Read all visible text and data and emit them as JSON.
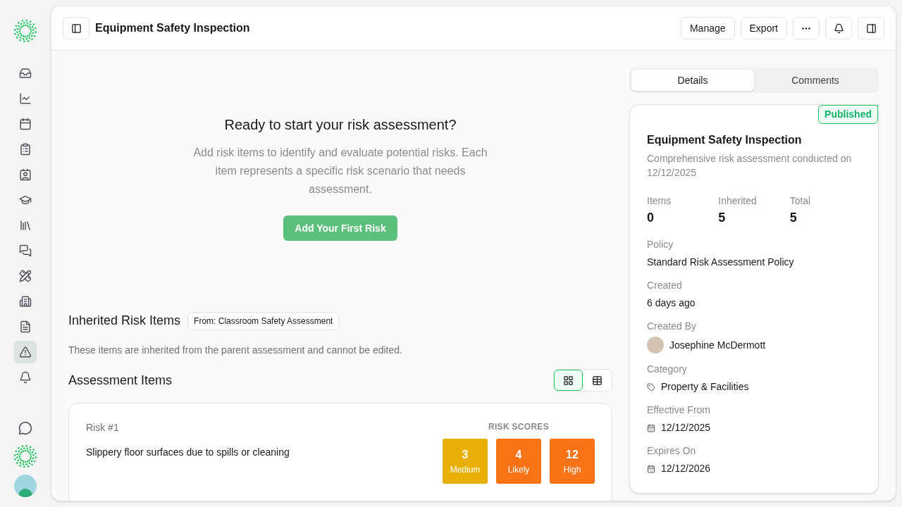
{
  "sidebar": {
    "items": [
      {
        "kind": "inbox",
        "selected": false
      },
      {
        "kind": "chart",
        "selected": false
      },
      {
        "kind": "calendar",
        "selected": false
      },
      {
        "kind": "clipboard",
        "selected": false
      },
      {
        "kind": "contacts",
        "selected": false
      },
      {
        "kind": "graduation",
        "selected": false
      },
      {
        "kind": "library",
        "selected": false
      },
      {
        "kind": "messages",
        "selected": false
      },
      {
        "kind": "pencil-ruler",
        "selected": false
      },
      {
        "kind": "building",
        "selected": false
      },
      {
        "kind": "document",
        "selected": false
      },
      {
        "kind": "warning",
        "selected": true
      },
      {
        "kind": "bell",
        "selected": false
      }
    ]
  },
  "header": {
    "title": "Equipment Safety Inspection",
    "buttons": [
      "Manage",
      "Export"
    ]
  },
  "empty_state": {
    "title": "Ready to start your risk assessment?",
    "text": "Add risk items to identify and evaluate potential risks. Each item represents a specific risk scenario that needs assessment.",
    "button": "Add Your First Risk"
  },
  "inherited": {
    "title": "Inherited Risk Items",
    "badge": "From: Classroom Safety Assessment",
    "note": "These items are inherited from the parent assessment and cannot be edited."
  },
  "assessment_items": {
    "title": "Assessment Items",
    "view_toggle": [
      {
        "kind": "grid",
        "selected": true
      },
      {
        "kind": "table",
        "selected": false
      }
    ],
    "risks": [
      {
        "label": "Risk #1",
        "text": "Slippery floor surfaces due to spills or cleaning",
        "scores_title": "RISK SCORES",
        "scores": [
          {
            "value": "3",
            "label": "Medium",
            "color": "#e8b007"
          },
          {
            "value": "4",
            "label": "Likely",
            "color": "#f97316"
          },
          {
            "value": "12",
            "label": "High",
            "color": "#f97316"
          }
        ]
      }
    ]
  },
  "tabs": [
    {
      "label": "Details",
      "selected": true
    },
    {
      "label": "Comments",
      "selected": false
    }
  ],
  "details": {
    "status": "Published",
    "title": "Equipment Safety Inspection",
    "subtitle": "Comprehensive risk assessment conducted on 12/12/2025",
    "stats": [
      {
        "label": "Items",
        "value": "0"
      },
      {
        "label": "Inherited",
        "value": "5"
      },
      {
        "label": "Total",
        "value": "5"
      }
    ],
    "fields": [
      {
        "kind": "text",
        "label": "Policy",
        "value": "Standard Risk Assessment Policy"
      },
      {
        "kind": "text",
        "label": "Created",
        "value": "6 days ago"
      },
      {
        "kind": "person",
        "label": "Created By",
        "value": "Josephine McDermott"
      },
      {
        "kind": "tag",
        "label": "Category",
        "value": "Property & Facilities"
      },
      {
        "kind": "date",
        "label": "Effective From",
        "value": "12/12/2025"
      },
      {
        "kind": "date",
        "label": "Expires On",
        "value": "12/12/2026"
      }
    ]
  }
}
